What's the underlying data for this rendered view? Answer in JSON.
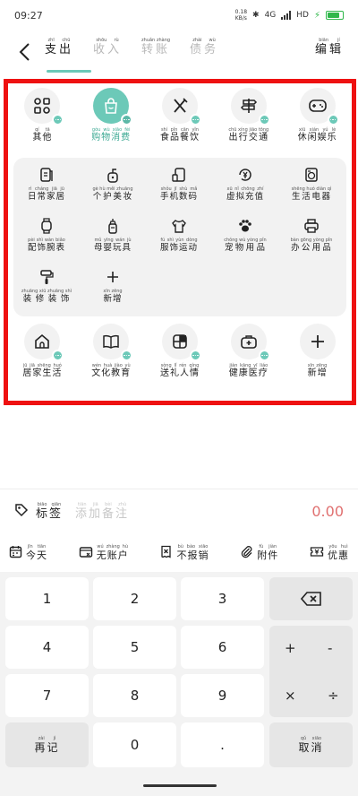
{
  "status": {
    "time": "09:27",
    "net_speed": "0.18",
    "net_unit": "KB/s",
    "network": "4G",
    "hd": "HD"
  },
  "header": {
    "tabs": [
      {
        "label": "支出",
        "pinyin": [
          "zhī",
          "chū"
        ]
      },
      {
        "label": "收入",
        "pinyin": [
          "shōu",
          "rù"
        ]
      },
      {
        "label": "转账",
        "pinyin": [
          "zhuǎn",
          "zhàng"
        ]
      },
      {
        "label": "债务",
        "pinyin": [
          "zhài",
          "wù"
        ]
      }
    ],
    "edit": {
      "label": "编辑",
      "pinyin": [
        "biān",
        "jí"
      ]
    }
  },
  "categories": {
    "row1": [
      {
        "label": "其他",
        "pinyin": [
          "qí",
          "tā"
        ],
        "icon": "grid-icon"
      },
      {
        "label": "购物消费",
        "pinyin": [
          "gòu",
          "wù",
          "xiāo",
          "fèi"
        ],
        "icon": "shopping-bag-icon"
      },
      {
        "label": "食品餐饮",
        "pinyin": [
          "shí",
          "pǐn",
          "cān",
          "yǐn"
        ],
        "icon": "fork-knife-icon"
      },
      {
        "label": "出行交通",
        "pinyin": [
          "chū",
          "xíng",
          "jiāo",
          "tōng"
        ],
        "icon": "signpost-icon"
      },
      {
        "label": "休闲娱乐",
        "pinyin": [
          "xiū",
          "xián",
          "yú",
          "lè"
        ],
        "icon": "gamepad-icon"
      }
    ],
    "sub": [
      {
        "label": "日常家居",
        "pinyin": [
          "rì",
          "cháng",
          "jiā",
          "jū"
        ],
        "icon": "tissue-icon"
      },
      {
        "label": "个护美妆",
        "pinyin": [
          "gè",
          "hù",
          "měi",
          "zhuāng"
        ],
        "icon": "bottle-icon"
      },
      {
        "label": "手机数码",
        "pinyin": [
          "shǒu",
          "jī",
          "shù",
          "mǎ"
        ],
        "icon": "phone-icon"
      },
      {
        "label": "虚拟充值",
        "pinyin": [
          "xū",
          "nǐ",
          "chōng",
          "zhí"
        ],
        "icon": "yen-recharge-icon"
      },
      {
        "label": "生活电器",
        "pinyin": [
          "shēng",
          "huó",
          "diàn",
          "qì"
        ],
        "icon": "washer-icon"
      },
      {
        "label": "配饰腕表",
        "pinyin": [
          "pèi",
          "shì",
          "wàn",
          "biǎo"
        ],
        "icon": "watch-icon"
      },
      {
        "label": "母婴玩具",
        "pinyin": [
          "mǔ",
          "yīng",
          "wán",
          "jù"
        ],
        "icon": "baby-bottle-icon"
      },
      {
        "label": "服饰运动",
        "pinyin": [
          "fú",
          "shì",
          "yùn",
          "dòng"
        ],
        "icon": "shirt-icon"
      },
      {
        "label": "宠物用品",
        "pinyin": [
          "chǒng",
          "wù",
          "yòng",
          "pǐn"
        ],
        "icon": "paw-icon"
      },
      {
        "label": "办公用品",
        "pinyin": [
          "bàn",
          "gōng",
          "yòng",
          "pǐn"
        ],
        "icon": "printer-icon"
      },
      {
        "label": "装修装饰",
        "pinyin": [
          "zhuāng",
          "xiū",
          "zhuāng",
          "shì"
        ],
        "icon": "paint-roller-icon"
      },
      {
        "label": "新增",
        "pinyin": [
          "xīn",
          "zēng"
        ],
        "icon": "plus-icon"
      }
    ],
    "row2": [
      {
        "label": "居家生活",
        "pinyin": [
          "jū",
          "jiā",
          "shēng",
          "huó"
        ],
        "icon": "house-icon"
      },
      {
        "label": "文化教育",
        "pinyin": [
          "wén",
          "huà",
          "jiào",
          "yù"
        ],
        "icon": "book-icon"
      },
      {
        "label": "送礼人情",
        "pinyin": [
          "sòng",
          "lǐ",
          "rén",
          "qíng"
        ],
        "icon": "gift-icon"
      },
      {
        "label": "健康医疗",
        "pinyin": [
          "jiàn",
          "kāng",
          "yī",
          "liáo"
        ],
        "icon": "medical-kit-icon"
      },
      {
        "label": "新增",
        "pinyin": [
          "xīn",
          "zēng"
        ],
        "icon": "plus-icon"
      }
    ]
  },
  "note_bar": {
    "tag": {
      "label": "标签",
      "pinyin": [
        "biāo",
        "qiān"
      ]
    },
    "note": {
      "label": "添加备注",
      "pinyin": [
        "tiān",
        "jiā",
        "bèi",
        "zhù"
      ]
    },
    "amount": "0.00"
  },
  "options": [
    {
      "label": "今天",
      "pinyin": [
        "jīn",
        "tiān"
      ],
      "icon": "calendar-icon"
    },
    {
      "label": "无账户",
      "pinyin": [
        "wú",
        "zhàng",
        "hù"
      ],
      "icon": "wallet-icon"
    },
    {
      "label": "不报销",
      "pinyin": [
        "bù",
        "bào",
        "xiāo"
      ],
      "icon": "receipt-icon"
    },
    {
      "label": "附件",
      "pinyin": [
        "fù",
        "jiàn"
      ],
      "icon": "paperclip-icon"
    },
    {
      "label": "优惠",
      "pinyin": [
        "yōu",
        "huì"
      ],
      "icon": "coupon-icon"
    }
  ],
  "keypad": {
    "digits": [
      "1",
      "2",
      "3",
      "4",
      "5",
      "6",
      "7",
      "8",
      "9",
      "0",
      "."
    ],
    "ops": [
      "+",
      "-",
      "×",
      "÷"
    ],
    "again": {
      "label": "再记",
      "pinyin": [
        "zài",
        "jì"
      ]
    },
    "cancel": {
      "label": "取消",
      "pinyin": [
        "qǔ",
        "xiāo"
      ]
    }
  },
  "colors": {
    "accent": "#6cc9b8",
    "highlight_border": "#ee1111",
    "amount": "#e07070"
  }
}
